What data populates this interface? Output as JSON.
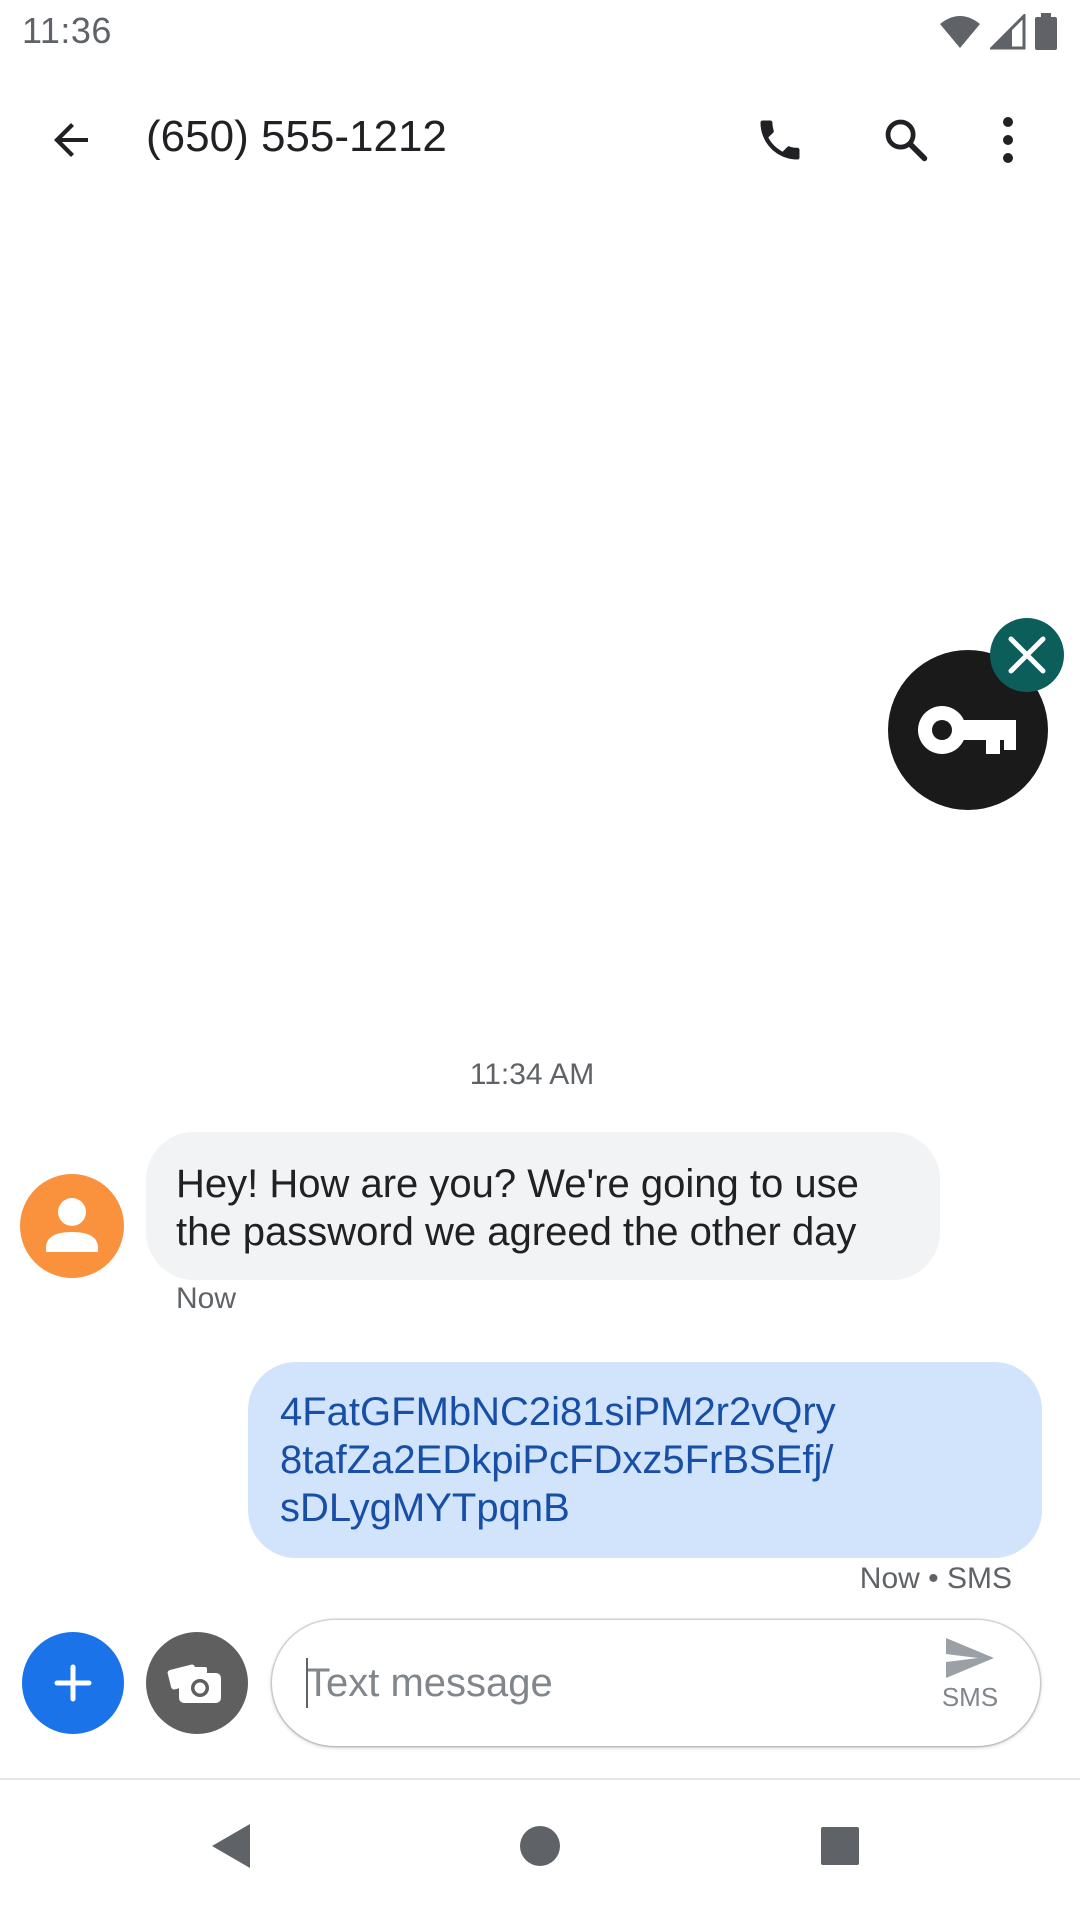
{
  "status_bar": {
    "time": "11:36",
    "icons": [
      "wifi-icon",
      "signal-icon",
      "battery-icon"
    ]
  },
  "app_bar": {
    "title": "(650) 555-1212",
    "icons": [
      "back-arrow-icon",
      "phone-icon",
      "search-icon",
      "more-vert-icon"
    ]
  },
  "floating_bubble": {
    "icon": "key-icon",
    "close_icon": "close-icon",
    "color": "#1a1a1a",
    "close_color": "#0b5e5a"
  },
  "conversation": {
    "timestamp": "11:34 AM",
    "messages": [
      {
        "direction": "incoming",
        "text": "Hey! How are you? We're going to use the password we agreed the other day",
        "meta": "Now",
        "avatar_color": "#f9913d"
      },
      {
        "direction": "outgoing",
        "text": "4FatGFMbNC2i81siPM2r2vQry\n8tafZa2EDkpiPcFDxz5FrBSEfj/\nsDLygMYTpqnB",
        "meta": "Now • SMS"
      }
    ]
  },
  "compose": {
    "placeholder": "Text message",
    "value": "",
    "send_label": "SMS",
    "add_color": "#1a73e8"
  },
  "nav_bar": {
    "icons": [
      "nav-back-icon",
      "nav-home-icon",
      "nav-recents-icon"
    ]
  }
}
